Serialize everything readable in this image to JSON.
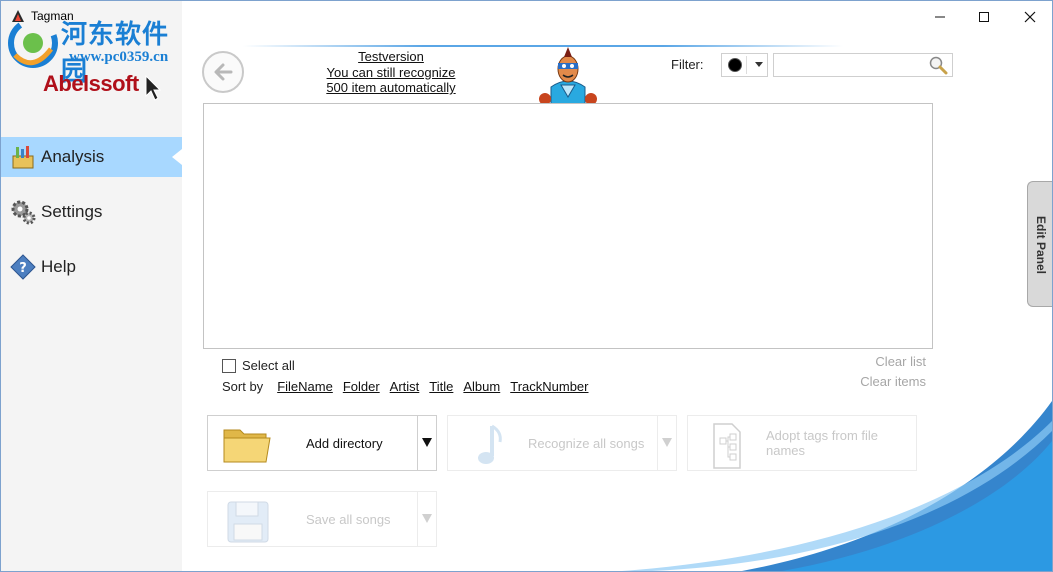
{
  "window": {
    "title": "Tagman",
    "minimize_icon": "minimize-icon",
    "maximize_icon": "maximize-icon",
    "close_icon": "close-icon"
  },
  "watermark": {
    "site_name": "河东软件园",
    "url": "www.pc0359.cn"
  },
  "brand": {
    "logo_text": "Abelssoft"
  },
  "sidebar": {
    "items": [
      {
        "label": "Analysis",
        "icon": "analysis-tools-icon",
        "active": true
      },
      {
        "label": "Settings",
        "icon": "gears-icon",
        "active": false
      },
      {
        "label": "Help",
        "icon": "help-diamond-icon",
        "active": false
      }
    ]
  },
  "header": {
    "back_icon": "back-arrow-icon",
    "promo": {
      "line1": "Testversion",
      "line2": "You can still recognize",
      "line3": "500 item automatically"
    },
    "mascot_icon": "superhero-mascot-icon",
    "filter_label": "Filter:",
    "filter_value_icon": "black-dot-icon",
    "search_value": "",
    "search_icon": "magnifier-icon"
  },
  "list": {
    "select_all_label": "Select all",
    "select_all_checked": false,
    "sort_by_label": "Sort by",
    "sort_fields": [
      "FileName",
      "Folder",
      "Artist",
      "Title",
      "Album",
      "TrackNumber"
    ],
    "clear_list_label": "Clear list",
    "clear_items_label": "Clear items"
  },
  "actions": {
    "add_directory": {
      "label": "Add directory",
      "icon": "folder-icon",
      "enabled": true
    },
    "recognize_all": {
      "label": "Recognize all songs",
      "icon": "music-note-icon",
      "enabled": false
    },
    "adopt_tags": {
      "label_line1": "Adopt tags from file",
      "label_line2": "names",
      "icon": "file-tree-icon",
      "enabled": false
    },
    "save_all": {
      "label": "Save all songs",
      "icon": "floppy-disk-icon",
      "enabled": false
    }
  },
  "edit_panel": {
    "label": "Edit Panel"
  },
  "colors": {
    "accent": "#a8d8ff",
    "logo_red": "#b0101a",
    "watermark_blue": "#1a7fd4",
    "disabled_text": "#c8c8c8"
  }
}
